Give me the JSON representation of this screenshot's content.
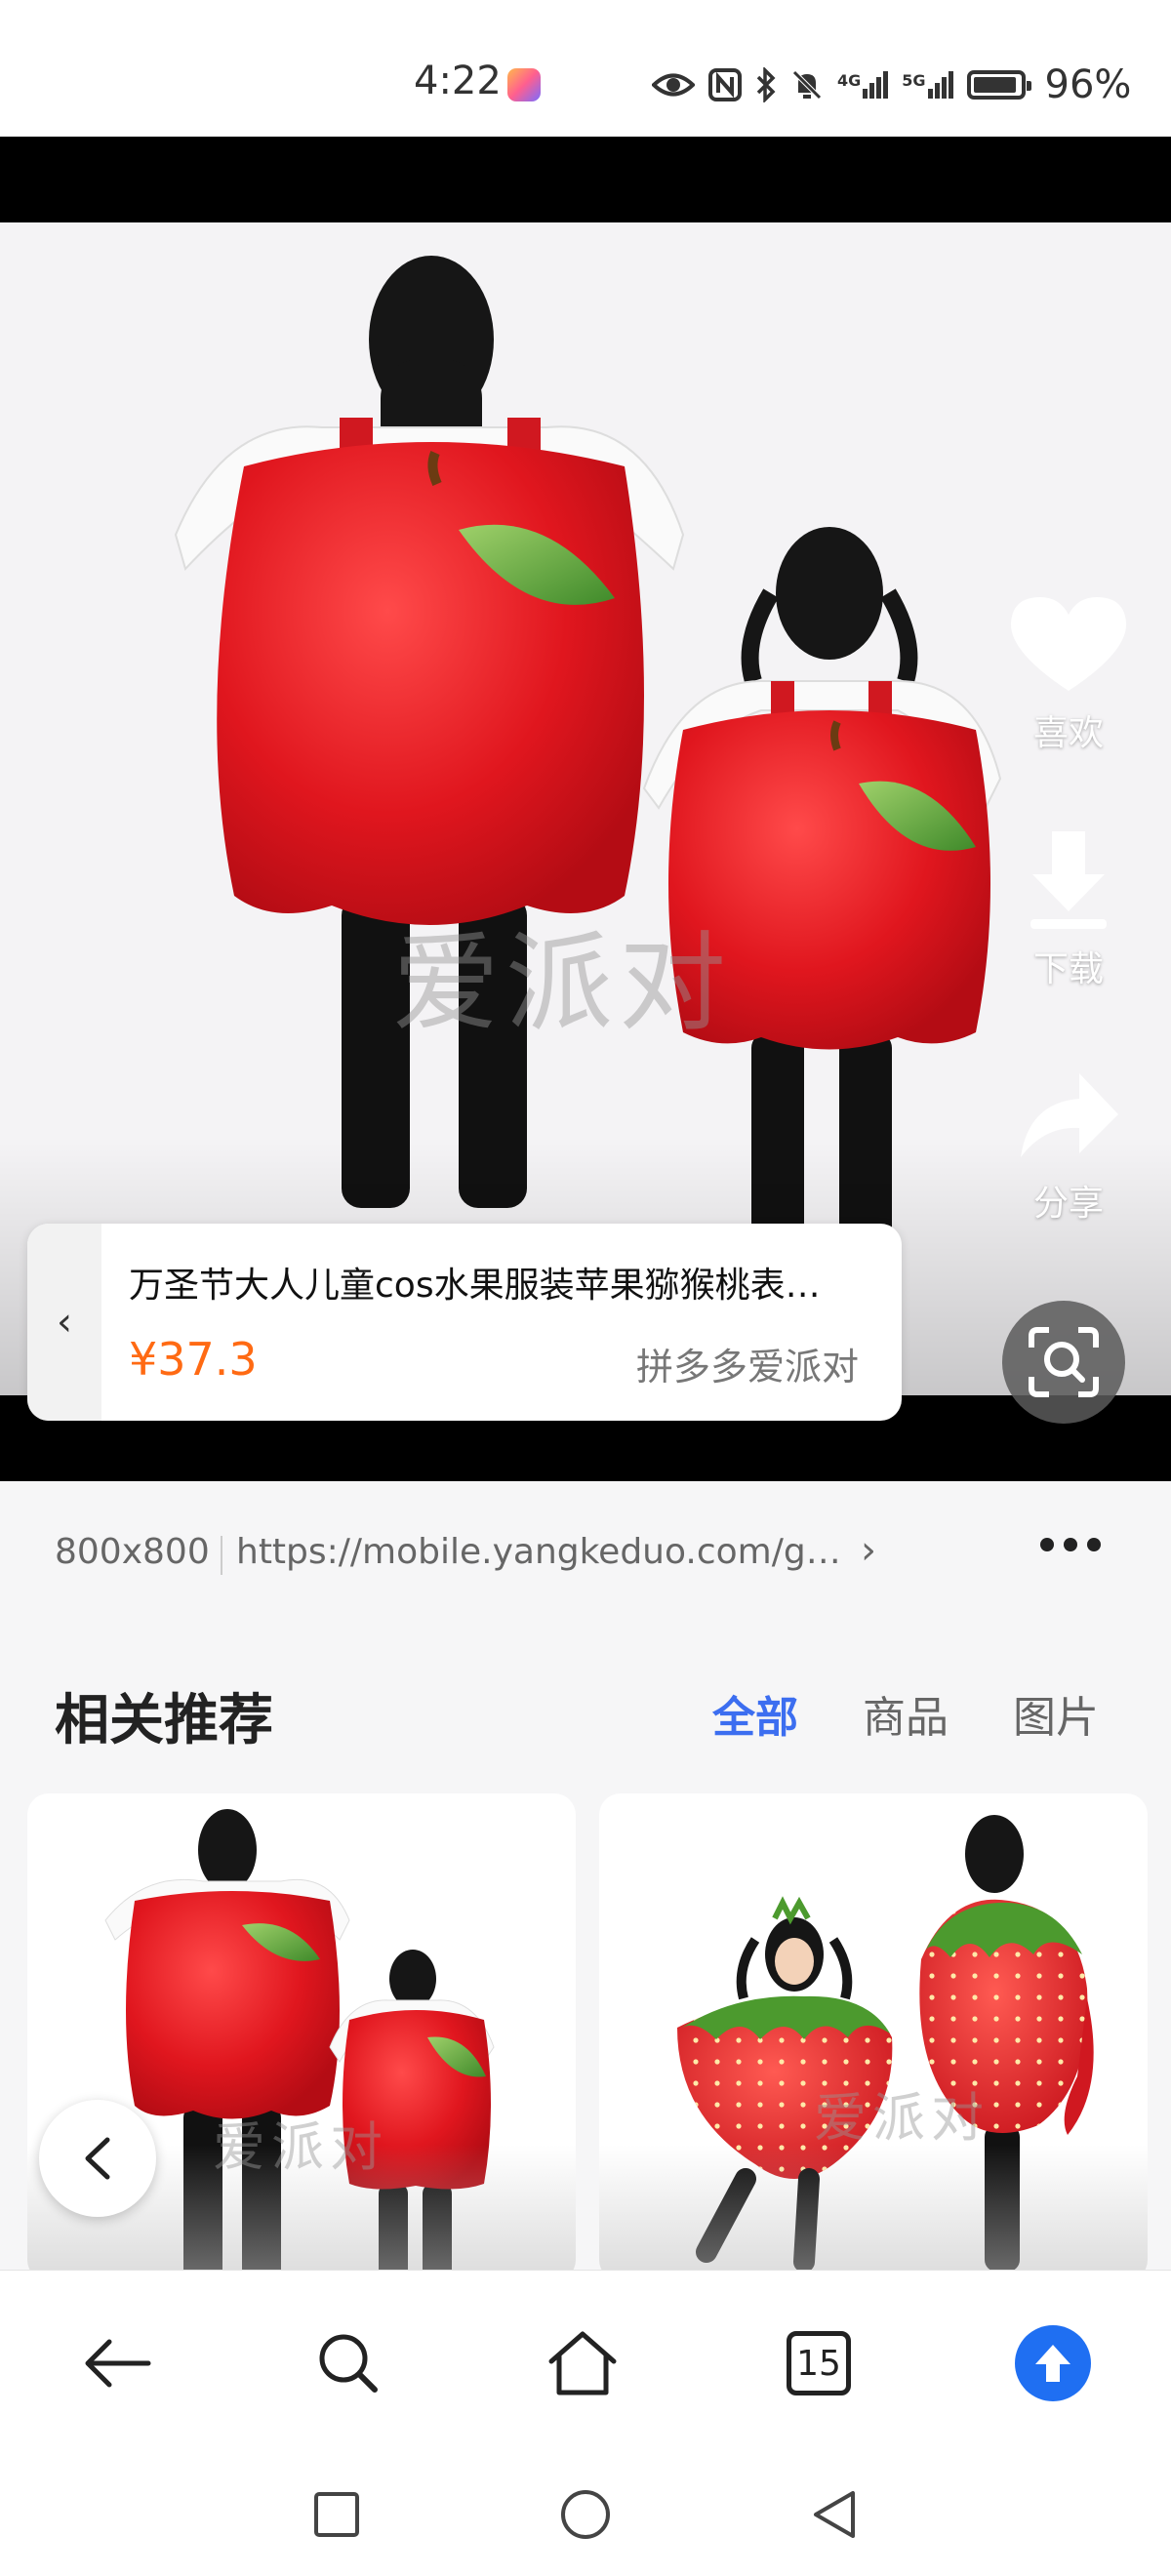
{
  "status_bar": {
    "time": "4:22",
    "network_4g": "4G",
    "network_5g": "5G",
    "battery_percent": "96%"
  },
  "hero": {
    "watermark": "爱派对",
    "actions": {
      "like_label": "喜欢",
      "download_label": "下载",
      "share_label": "分享"
    }
  },
  "product_card": {
    "title": "万圣节大人儿童cos水果服装苹果猕猴桃表演服",
    "price": "¥37.3",
    "shop": "拼多多爱派对"
  },
  "image_info": {
    "dimensions": "800x800",
    "url": "https://mobile.yangkeduo.com/goods.html"
  },
  "recommendations": {
    "title": "相关推荐",
    "tabs": [
      {
        "label": "全部",
        "active": true
      },
      {
        "label": "商品",
        "active": false
      },
      {
        "label": "图片",
        "active": false
      }
    ],
    "cards": [
      {
        "watermark": "爱派对"
      },
      {
        "watermark": "爱派对"
      }
    ]
  },
  "browser_bar": {
    "tab_count": "15"
  },
  "colors": {
    "price": "#ff6a13",
    "active_tab": "#3c6ef0",
    "upload_button": "#1f6ff2",
    "apple_red": "#e0161e"
  },
  "icons": {
    "status": [
      "eye-icon",
      "nfc-icon",
      "bluetooth-icon",
      "mute-bell-icon",
      "signal-4g-icon",
      "signal-5g-icon",
      "battery-icon"
    ],
    "hero": [
      "heart-icon",
      "download-icon",
      "share-icon",
      "lens-search-icon"
    ],
    "browser": [
      "back-arrow-icon",
      "search-icon",
      "home-icon",
      "tabs-icon",
      "upload-icon"
    ],
    "system": [
      "recents-square-icon",
      "home-circle-icon",
      "back-triangle-icon"
    ]
  }
}
